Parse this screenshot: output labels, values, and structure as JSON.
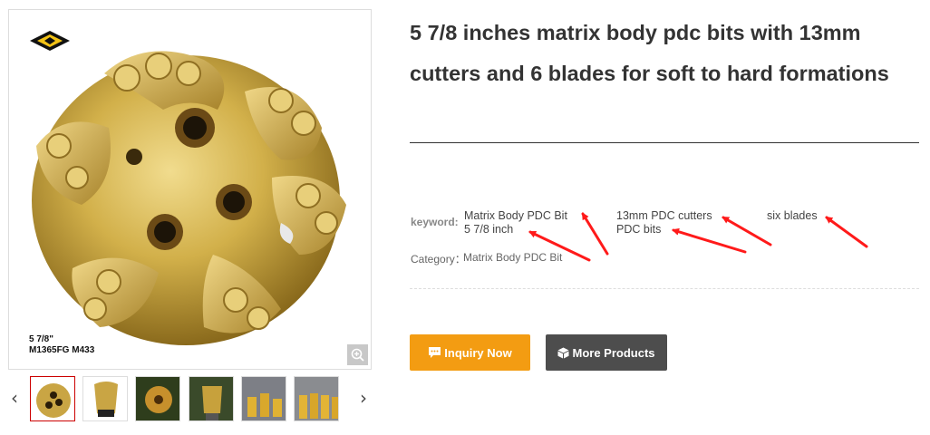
{
  "product": {
    "title": "5 7/8 inches matrix body pdc bits with 13mm cutters and 6 blades for soft to hard formations",
    "image_caption_line1": "5 7/8\"",
    "image_caption_line2": "M1365FG M433"
  },
  "keywords": {
    "label": "keyword:",
    "items": [
      "Matrix Body PDC Bit",
      "5 7/8 inch",
      "13mm PDC cutters",
      "PDC bits",
      "six blades"
    ]
  },
  "category": {
    "label": "Category：",
    "value": "Matrix Body PDC Bit"
  },
  "buttons": {
    "inquiry": "Inquiry Now",
    "more": "More Products"
  },
  "gallery": {
    "prev_arrow": "‹",
    "next_arrow": "›",
    "thumbnail_count": 6,
    "active_thumbnail": 1
  },
  "colors": {
    "inquiry_button": "#f39c12",
    "more_button": "#4d4d4d",
    "annotation_arrow": "#ff1a1a",
    "active_thumb_border": "#cc0000"
  },
  "icons": [
    "chat-icon",
    "cube-icon",
    "zoom-icon",
    "brand-logo",
    "chevron-left-icon",
    "chevron-right-icon"
  ]
}
